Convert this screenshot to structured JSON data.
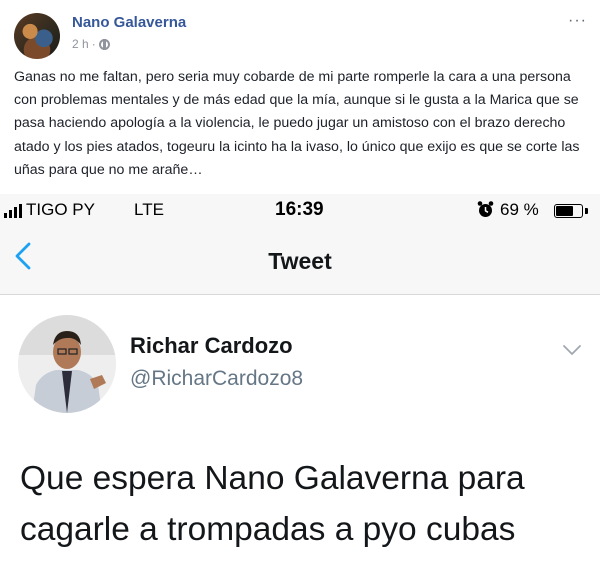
{
  "facebook_post": {
    "author": "Nano Galaverna",
    "time": "2 h",
    "separator": "·",
    "menu": "···",
    "text": "Ganas no me faltan, pero seria muy cobarde de mi parte romperle la cara a una persona con problemas mentales y de más edad que la mía, aunque si le gusta a la Marica que se pasa haciendo apología a la violencia, le puedo jugar un amistoso con el brazo derecho atado y los pies atados, togeuru la icinto ha la ivaso, lo único que exijo es que se corte las uñas para que no me arañe…"
  },
  "phone": {
    "status_bar": {
      "carrier": "TIGO PY",
      "network": "LTE",
      "time": "16:39",
      "alarm_icon": "alarm-clock-icon",
      "battery_percent": "69 %",
      "battery_level": 0.69
    },
    "nav": {
      "title": "Tweet",
      "back_icon": "chevron-left-icon",
      "accent": "#1da1f2"
    },
    "tweet": {
      "name": "Richar Cardozo",
      "handle": "@RicharCardozo8",
      "text": "Que espera Nano Galaverna para cagarle a trompadas a pyo cubas",
      "menu_icon": "chevron-down-icon"
    }
  }
}
